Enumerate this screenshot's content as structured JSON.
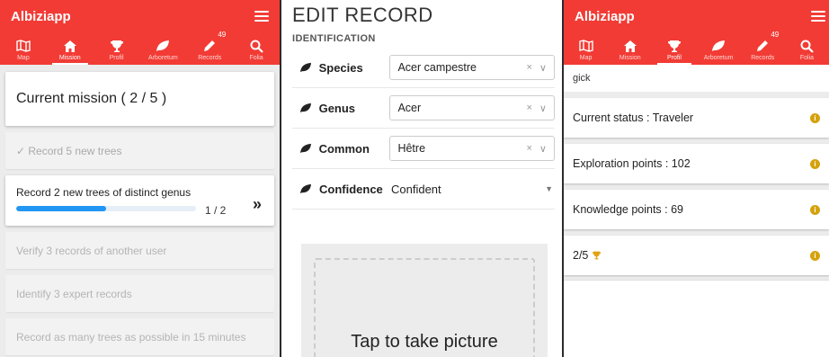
{
  "colors": {
    "header": "#f23b35",
    "progress": "#2196f3",
    "info": "#d4a20d"
  },
  "app": {
    "title": "Albiziapp"
  },
  "tabs": [
    {
      "label": "Map",
      "icon": "map-icon"
    },
    {
      "label": "Mission",
      "icon": "home-icon"
    },
    {
      "label": "Profil",
      "icon": "trophy-icon"
    },
    {
      "label": "Arboretum",
      "icon": "leaf-icon"
    },
    {
      "label": "Records",
      "icon": "pencil-icon",
      "badge": "49"
    },
    {
      "label": "Folia",
      "icon": "search-icon"
    }
  ],
  "mission": {
    "title": "Current mission ( 2 / 5 )",
    "done_task": "✓ Record 5 new trees",
    "active_task": {
      "label": "Record 2 new trees of distinct genus",
      "count": "1 / 2",
      "progress": 0.5,
      "chevron": "»"
    },
    "pending_tasks": [
      "Verify 3 records of another user",
      "Identify 3 expert records",
      "Record as many trees as possible in 15 minutes"
    ]
  },
  "edit": {
    "title": "EDIT RECORD",
    "section": "IDENTIFICATION",
    "species_label": "Species",
    "species_value": "Acer campestre",
    "genus_label": "Genus",
    "genus_value": "Acer",
    "common_label": "Common",
    "common_value": "Hêtre",
    "clear_symbol": "×",
    "dropdown_symbol": "∨",
    "confidence_label": "Confidence",
    "confidence_value": "Confident",
    "photo_text": "Tap to take picture"
  },
  "profile": {
    "username": "gick",
    "stats": [
      {
        "label": "Current status : Traveler"
      },
      {
        "label": "Exploration points : 102"
      },
      {
        "label": "Knowledge points : 69"
      },
      {
        "label": "2/5"
      }
    ],
    "info_symbol": "i"
  }
}
